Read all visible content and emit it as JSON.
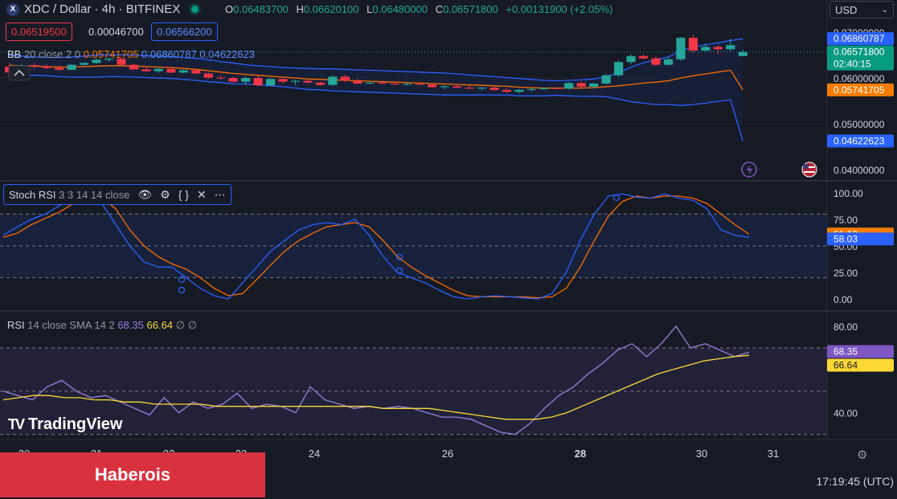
{
  "header": {
    "symbol": "XDC / Dollar · 4h · BITFINEX",
    "logo_letter": "X",
    "ohlc": [
      {
        "key": "O",
        "value": "0.06483700"
      },
      {
        "key": "H",
        "value": "0.06620100"
      },
      {
        "key": "L",
        "value": "0.06480000"
      },
      {
        "key": "C",
        "value": "0.06571800"
      }
    ],
    "change": "+0.00131900 (+2.05%)",
    "bid": "0.06519500",
    "spread": "0.00046700",
    "ask": "0.06566200",
    "currency": "USD"
  },
  "bb": {
    "name": "BB",
    "params": "20 close 2 0",
    "basis": "0.05741705",
    "upper": "0.06860787",
    "lower": "0.04622623"
  },
  "stoch": {
    "name": "Stoch RSI",
    "params": "3 3 14 14 close",
    "k": "58.03",
    "d": "61.13",
    "icons": [
      "eye-icon",
      "gear-icon",
      "braces-icon",
      "close-icon",
      "more-icon"
    ]
  },
  "rsi": {
    "name": "RSI",
    "params": "14 close SMA 14 2",
    "rsi": "68.35",
    "sma": "66.64",
    "na1": "∅",
    "na2": "∅"
  },
  "price_axis": {
    "ticks": [
      "0.07000000",
      "0.06000000",
      "0.05000000",
      "0.04000000"
    ],
    "last_price": "0.06571800",
    "countdown": "02:40:15"
  },
  "stoch_axis": {
    "ticks": [
      "100.00",
      "75.00",
      "50.00",
      "25.00",
      "0.00"
    ]
  },
  "rsi_axis": {
    "ticks": [
      "80.00",
      "40.00"
    ]
  },
  "time_axis": {
    "ticks": [
      "20",
      "21",
      "22",
      "23",
      "24",
      "26",
      "28",
      "30",
      "31"
    ]
  },
  "branding": {
    "logo_text": "TradingView",
    "banner": "Haberois"
  },
  "clock": "17:19:45 (UTC)",
  "colors": {
    "up": "#26a69a",
    "down": "#f23645",
    "bb_band": "#2962ff",
    "bb_basis": "#ff6d00",
    "stoch_k": "#2962ff",
    "stoch_d": "#ff6d00",
    "rsi": "#7e57c2",
    "rsi_sma": "#fdd835"
  },
  "chart_data": [
    {
      "type": "candlestick",
      "title": "XDC / Dollar · 4h · BITFINEX",
      "ylim": [
        0.0377,
        0.0725
      ],
      "x_ticks": [
        "20",
        "21",
        "22",
        "23",
        "24",
        "26",
        "28",
        "30",
        "31"
      ],
      "candles": [
        {
          "o": 0.0625,
          "h": 0.0633,
          "l": 0.0611,
          "c": 0.0612
        },
        {
          "o": 0.0612,
          "h": 0.063,
          "l": 0.061,
          "c": 0.0628
        },
        {
          "o": 0.0628,
          "h": 0.0633,
          "l": 0.062,
          "c": 0.0626
        },
        {
          "o": 0.0626,
          "h": 0.063,
          "l": 0.062,
          "c": 0.0622
        },
        {
          "o": 0.0622,
          "h": 0.0627,
          "l": 0.0616,
          "c": 0.0618
        },
        {
          "o": 0.0618,
          "h": 0.063,
          "l": 0.0617,
          "c": 0.0629
        },
        {
          "o": 0.0629,
          "h": 0.0635,
          "l": 0.0627,
          "c": 0.0633
        },
        {
          "o": 0.0633,
          "h": 0.0643,
          "l": 0.0631,
          "c": 0.064
        },
        {
          "o": 0.064,
          "h": 0.0645,
          "l": 0.0636,
          "c": 0.0642
        },
        {
          "o": 0.0642,
          "h": 0.0645,
          "l": 0.0626,
          "c": 0.0629
        },
        {
          "o": 0.0629,
          "h": 0.0632,
          "l": 0.0617,
          "c": 0.0619
        },
        {
          "o": 0.0619,
          "h": 0.0625,
          "l": 0.0613,
          "c": 0.0615
        },
        {
          "o": 0.0615,
          "h": 0.0622,
          "l": 0.0611,
          "c": 0.062
        },
        {
          "o": 0.062,
          "h": 0.0623,
          "l": 0.061,
          "c": 0.0612
        },
        {
          "o": 0.0612,
          "h": 0.0619,
          "l": 0.061,
          "c": 0.0617
        },
        {
          "o": 0.0617,
          "h": 0.0618,
          "l": 0.0608,
          "c": 0.061
        },
        {
          "o": 0.061,
          "h": 0.0612,
          "l": 0.0598,
          "c": 0.0601
        },
        {
          "o": 0.0601,
          "h": 0.0606,
          "l": 0.0597,
          "c": 0.06
        },
        {
          "o": 0.06,
          "h": 0.0603,
          "l": 0.059,
          "c": 0.0592
        },
        {
          "o": 0.0592,
          "h": 0.0603,
          "l": 0.0585,
          "c": 0.06
        },
        {
          "o": 0.06,
          "h": 0.0605,
          "l": 0.0582,
          "c": 0.0584
        },
        {
          "o": 0.0584,
          "h": 0.06,
          "l": 0.0582,
          "c": 0.0598
        },
        {
          "o": 0.0598,
          "h": 0.0599,
          "l": 0.0588,
          "c": 0.0592
        },
        {
          "o": 0.0592,
          "h": 0.0596,
          "l": 0.0585,
          "c": 0.0594
        },
        {
          "o": 0.0594,
          "h": 0.0597,
          "l": 0.0588,
          "c": 0.059
        },
        {
          "o": 0.059,
          "h": 0.0593,
          "l": 0.0583,
          "c": 0.0585
        },
        {
          "o": 0.0585,
          "h": 0.0605,
          "l": 0.0583,
          "c": 0.0603
        },
        {
          "o": 0.0603,
          "h": 0.0607,
          "l": 0.0591,
          "c": 0.0594
        },
        {
          "o": 0.0594,
          "h": 0.0599,
          "l": 0.0586,
          "c": 0.0588
        },
        {
          "o": 0.0588,
          "h": 0.0592,
          "l": 0.0585,
          "c": 0.059
        },
        {
          "o": 0.059,
          "h": 0.0594,
          "l": 0.0586,
          "c": 0.0588
        },
        {
          "o": 0.0588,
          "h": 0.0592,
          "l": 0.0584,
          "c": 0.0586
        },
        {
          "o": 0.0586,
          "h": 0.059,
          "l": 0.0583,
          "c": 0.0587
        },
        {
          "o": 0.0587,
          "h": 0.0591,
          "l": 0.0584,
          "c": 0.0586
        },
        {
          "o": 0.0586,
          "h": 0.0589,
          "l": 0.0578,
          "c": 0.058
        },
        {
          "o": 0.058,
          "h": 0.0584,
          "l": 0.0575,
          "c": 0.0582
        },
        {
          "o": 0.0582,
          "h": 0.0586,
          "l": 0.0578,
          "c": 0.0579
        },
        {
          "o": 0.0579,
          "h": 0.0583,
          "l": 0.0575,
          "c": 0.0577
        },
        {
          "o": 0.0577,
          "h": 0.0581,
          "l": 0.0573,
          "c": 0.0579
        },
        {
          "o": 0.0579,
          "h": 0.0583,
          "l": 0.0572,
          "c": 0.0574
        },
        {
          "o": 0.0574,
          "h": 0.0578,
          "l": 0.0568,
          "c": 0.057
        },
        {
          "o": 0.057,
          "h": 0.0576,
          "l": 0.0566,
          "c": 0.0574
        },
        {
          "o": 0.0574,
          "h": 0.0578,
          "l": 0.057,
          "c": 0.0576
        },
        {
          "o": 0.0576,
          "h": 0.058,
          "l": 0.0573,
          "c": 0.0578
        },
        {
          "o": 0.0578,
          "h": 0.058,
          "l": 0.0575,
          "c": 0.0577
        },
        {
          "o": 0.0577,
          "h": 0.0592,
          "l": 0.0575,
          "c": 0.0589
        },
        {
          "o": 0.0589,
          "h": 0.0593,
          "l": 0.0578,
          "c": 0.0581
        },
        {
          "o": 0.0581,
          "h": 0.059,
          "l": 0.0578,
          "c": 0.0588
        },
        {
          "o": 0.0588,
          "h": 0.061,
          "l": 0.0586,
          "c": 0.0606
        },
        {
          "o": 0.0606,
          "h": 0.0638,
          "l": 0.0603,
          "c": 0.0635
        },
        {
          "o": 0.0635,
          "h": 0.0652,
          "l": 0.063,
          "c": 0.0648
        },
        {
          "o": 0.0648,
          "h": 0.0652,
          "l": 0.064,
          "c": 0.0643
        },
        {
          "o": 0.0643,
          "h": 0.0648,
          "l": 0.0626,
          "c": 0.0629
        },
        {
          "o": 0.0629,
          "h": 0.0646,
          "l": 0.0627,
          "c": 0.0641
        },
        {
          "o": 0.0641,
          "h": 0.069,
          "l": 0.0638,
          "c": 0.0688
        },
        {
          "o": 0.0688,
          "h": 0.0695,
          "l": 0.0655,
          "c": 0.066
        },
        {
          "o": 0.066,
          "h": 0.0675,
          "l": 0.0658,
          "c": 0.0668
        },
        {
          "o": 0.0668,
          "h": 0.0672,
          "l": 0.0652,
          "c": 0.0663
        },
        {
          "o": 0.0663,
          "h": 0.0686,
          "l": 0.0658,
          "c": 0.0672
        },
        {
          "o": 0.0648,
          "h": 0.0662,
          "l": 0.0648,
          "c": 0.0657
        }
      ],
      "bb_upper": [
        0.065,
        0.0648,
        0.0646,
        0.0645,
        0.0645,
        0.0646,
        0.0648,
        0.065,
        0.0651,
        0.0651,
        0.065,
        0.0649,
        0.0648,
        0.0647,
        0.0645,
        0.0643,
        0.064,
        0.0636,
        0.0633,
        0.0629,
        0.0627,
        0.0625,
        0.0623,
        0.0622,
        0.0621,
        0.062,
        0.062,
        0.0619,
        0.0618,
        0.0617,
        0.0616,
        0.0615,
        0.0614,
        0.0613,
        0.0612,
        0.0611,
        0.0609,
        0.0607,
        0.0605,
        0.0603,
        0.0601,
        0.0599,
        0.0597,
        0.0595,
        0.0594,
        0.0595,
        0.0596,
        0.0598,
        0.0603,
        0.0612,
        0.0624,
        0.0633,
        0.064,
        0.0646,
        0.066,
        0.0668,
        0.0673,
        0.0677,
        0.0682,
        0.0686
      ],
      "bb_basis": [
        0.0628,
        0.0627,
        0.0626,
        0.0625,
        0.0624,
        0.0624,
        0.0625,
        0.0626,
        0.0627,
        0.0627,
        0.0626,
        0.0625,
        0.0624,
        0.0623,
        0.0621,
        0.0619,
        0.0616,
        0.0613,
        0.061,
        0.0608,
        0.0606,
        0.0604,
        0.0602,
        0.06,
        0.0598,
        0.0597,
        0.0596,
        0.0595,
        0.0594,
        0.0593,
        0.0592,
        0.0591,
        0.059,
        0.0589,
        0.0588,
        0.0587,
        0.0586,
        0.0585,
        0.0584,
        0.0583,
        0.0582,
        0.058,
        0.0579,
        0.0578,
        0.0578,
        0.0578,
        0.0578,
        0.0579,
        0.0581,
        0.0583,
        0.0586,
        0.0589,
        0.0591,
        0.0594,
        0.06,
        0.0605,
        0.0609,
        0.0613,
        0.0617,
        0.0574
      ],
      "bb_lower": [
        0.0606,
        0.0606,
        0.0606,
        0.0605,
        0.0603,
        0.0602,
        0.0602,
        0.0602,
        0.0603,
        0.0603,
        0.0602,
        0.0601,
        0.06,
        0.0599,
        0.0597,
        0.0595,
        0.0592,
        0.059,
        0.0587,
        0.0587,
        0.0585,
        0.0583,
        0.0581,
        0.0578,
        0.0575,
        0.0574,
        0.0572,
        0.0571,
        0.057,
        0.0569,
        0.0568,
        0.0567,
        0.0566,
        0.0565,
        0.0564,
        0.0563,
        0.0563,
        0.0563,
        0.0563,
        0.0563,
        0.0563,
        0.0561,
        0.0561,
        0.0561,
        0.0562,
        0.0561,
        0.056,
        0.056,
        0.0559,
        0.0554,
        0.0548,
        0.0545,
        0.0542,
        0.0542,
        0.054,
        0.0542,
        0.0545,
        0.0549,
        0.0552,
        0.0462
      ]
    },
    {
      "type": "line",
      "title": "Stoch RSI 3 3 14 14 close",
      "ylim": [
        0,
        100
      ],
      "series": [
        {
          "name": "K",
          "values": [
            60,
            68,
            75,
            80,
            88,
            95,
            98,
            90,
            70,
            50,
            35,
            30,
            30,
            20,
            10,
            3,
            0,
            15,
            30,
            45,
            55,
            65,
            70,
            72,
            70,
            75,
            60,
            40,
            25,
            20,
            15,
            8,
            2,
            0,
            2,
            3,
            2,
            1,
            0,
            5,
            25,
            55,
            80,
            97,
            99,
            96,
            95,
            99,
            95,
            93,
            85,
            65,
            60,
            58
          ]
        },
        {
          "name": "D",
          "values": [
            58,
            62,
            70,
            76,
            82,
            90,
            95,
            95,
            85,
            65,
            50,
            40,
            33,
            28,
            20,
            10,
            3,
            5,
            18,
            32,
            45,
            55,
            62,
            68,
            70,
            72,
            68,
            55,
            40,
            30,
            22,
            15,
            8,
            3,
            2,
            2,
            2,
            2,
            1,
            2,
            10,
            30,
            55,
            78,
            92,
            97,
            95,
            97,
            97,
            95,
            90,
            80,
            70,
            61
          ]
        }
      ]
    },
    {
      "type": "line",
      "title": "RSI 14 close SMA 14 2",
      "ylim": [
        28,
        86
      ],
      "series": [
        {
          "name": "RSI",
          "values": [
            50,
            48,
            46,
            52,
            55,
            50,
            47,
            48,
            45,
            42,
            39,
            47,
            40,
            45,
            42,
            44,
            49,
            42,
            44,
            43,
            40,
            52,
            46,
            44,
            42,
            43,
            42,
            43,
            42,
            40,
            38,
            38,
            37,
            34,
            31,
            30,
            35,
            42,
            48,
            52,
            58,
            63,
            69,
            72,
            66,
            72,
            80,
            70,
            72,
            69,
            66,
            68
          ]
        },
        {
          "name": "SMA",
          "values": [
            46,
            47,
            48,
            48,
            47,
            47,
            46,
            46,
            45,
            45,
            44,
            44,
            44,
            44,
            43,
            43,
            43,
            43,
            43,
            43,
            43,
            43,
            43,
            43,
            43,
            42,
            42,
            42,
            42,
            41,
            40,
            39,
            38,
            37,
            37,
            37,
            38,
            40,
            43,
            46,
            49,
            52,
            55,
            58,
            60,
            62,
            64,
            65,
            66,
            66.6
          ]
        }
      ]
    }
  ]
}
